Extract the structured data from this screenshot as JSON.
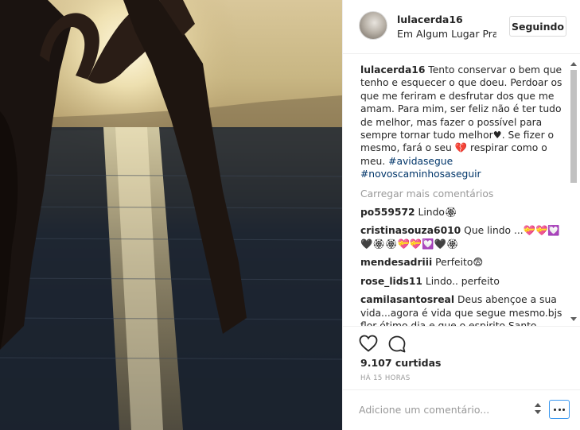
{
  "post": {
    "username": "lulacerda16",
    "location": "Em Algum Lugar Pra...",
    "follow_label": "Seguindo",
    "caption": {
      "username": "lulacerda16",
      "text": " Tento conservar o bem que tenho e esquecer o que doeu. Perdoar os que me feriram e desfrutar dos que me amam. Para mim, ser feliz não é ter tudo de melhor, mas fazer o possível para sempre tornar tudo melhor♥. Se fizer o mesmo, fará o seu 💔 respirar como o meu. ",
      "hashtag1": "#avidasegue",
      "hashtag2": "#novoscaminhosaseguir"
    },
    "load_more_label": "Carregar mais comentários",
    "comments": [
      {
        "username": "po559572",
        "text": " Lindo🏵"
      },
      {
        "username": "cristinasouza6010",
        "text": " Que lindo ...💝💝💟🖤🏵🏵💝💝💟🖤🏵"
      },
      {
        "username": "mendesadriii",
        "text": " Perfeito😨"
      },
      {
        "username": "rose_lids11",
        "text": " Lindo.. perfeito"
      },
      {
        "username": "camilasantosreal",
        "text": " Deus abençoe a sua vida...agora é vida que segue mesmo.bjs flor ótimo dia e que o espirito Santo esteja sempre presente em sua vida😉🙆"
      }
    ],
    "likes": "9.107 curtidas",
    "time": "HÁ 15 HORAS",
    "comment_placeholder": "Adicione um comentário..."
  },
  "icons": {
    "like": "heart-outline-icon",
    "comment": "speech-bubble-icon",
    "more": "ellipsis-icon"
  },
  "colors": {
    "hashtag": "#003569",
    "muted": "#999999",
    "accent": "#3897f0"
  }
}
